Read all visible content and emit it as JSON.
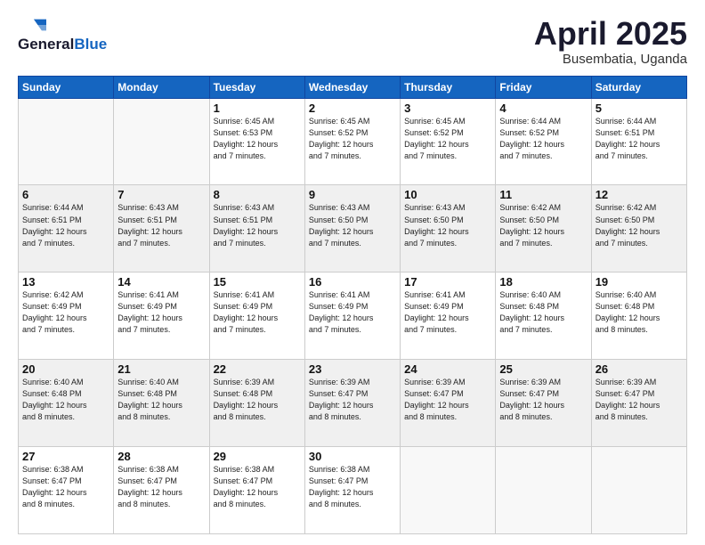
{
  "header": {
    "logo_general": "General",
    "logo_blue": "Blue",
    "month_title": "April 2025",
    "location": "Busembatia, Uganda"
  },
  "days_of_week": [
    "Sunday",
    "Monday",
    "Tuesday",
    "Wednesday",
    "Thursday",
    "Friday",
    "Saturday"
  ],
  "weeks": [
    {
      "shade": "white",
      "days": [
        {
          "num": "",
          "info": ""
        },
        {
          "num": "",
          "info": ""
        },
        {
          "num": "1",
          "info": "Sunrise: 6:45 AM\nSunset: 6:53 PM\nDaylight: 12 hours\nand 7 minutes."
        },
        {
          "num": "2",
          "info": "Sunrise: 6:45 AM\nSunset: 6:52 PM\nDaylight: 12 hours\nand 7 minutes."
        },
        {
          "num": "3",
          "info": "Sunrise: 6:45 AM\nSunset: 6:52 PM\nDaylight: 12 hours\nand 7 minutes."
        },
        {
          "num": "4",
          "info": "Sunrise: 6:44 AM\nSunset: 6:52 PM\nDaylight: 12 hours\nand 7 minutes."
        },
        {
          "num": "5",
          "info": "Sunrise: 6:44 AM\nSunset: 6:51 PM\nDaylight: 12 hours\nand 7 minutes."
        }
      ]
    },
    {
      "shade": "shaded",
      "days": [
        {
          "num": "6",
          "info": "Sunrise: 6:44 AM\nSunset: 6:51 PM\nDaylight: 12 hours\nand 7 minutes."
        },
        {
          "num": "7",
          "info": "Sunrise: 6:43 AM\nSunset: 6:51 PM\nDaylight: 12 hours\nand 7 minutes."
        },
        {
          "num": "8",
          "info": "Sunrise: 6:43 AM\nSunset: 6:51 PM\nDaylight: 12 hours\nand 7 minutes."
        },
        {
          "num": "9",
          "info": "Sunrise: 6:43 AM\nSunset: 6:50 PM\nDaylight: 12 hours\nand 7 minutes."
        },
        {
          "num": "10",
          "info": "Sunrise: 6:43 AM\nSunset: 6:50 PM\nDaylight: 12 hours\nand 7 minutes."
        },
        {
          "num": "11",
          "info": "Sunrise: 6:42 AM\nSunset: 6:50 PM\nDaylight: 12 hours\nand 7 minutes."
        },
        {
          "num": "12",
          "info": "Sunrise: 6:42 AM\nSunset: 6:50 PM\nDaylight: 12 hours\nand 7 minutes."
        }
      ]
    },
    {
      "shade": "white",
      "days": [
        {
          "num": "13",
          "info": "Sunrise: 6:42 AM\nSunset: 6:49 PM\nDaylight: 12 hours\nand 7 minutes."
        },
        {
          "num": "14",
          "info": "Sunrise: 6:41 AM\nSunset: 6:49 PM\nDaylight: 12 hours\nand 7 minutes."
        },
        {
          "num": "15",
          "info": "Sunrise: 6:41 AM\nSunset: 6:49 PM\nDaylight: 12 hours\nand 7 minutes."
        },
        {
          "num": "16",
          "info": "Sunrise: 6:41 AM\nSunset: 6:49 PM\nDaylight: 12 hours\nand 7 minutes."
        },
        {
          "num": "17",
          "info": "Sunrise: 6:41 AM\nSunset: 6:49 PM\nDaylight: 12 hours\nand 7 minutes."
        },
        {
          "num": "18",
          "info": "Sunrise: 6:40 AM\nSunset: 6:48 PM\nDaylight: 12 hours\nand 7 minutes."
        },
        {
          "num": "19",
          "info": "Sunrise: 6:40 AM\nSunset: 6:48 PM\nDaylight: 12 hours\nand 8 minutes."
        }
      ]
    },
    {
      "shade": "shaded",
      "days": [
        {
          "num": "20",
          "info": "Sunrise: 6:40 AM\nSunset: 6:48 PM\nDaylight: 12 hours\nand 8 minutes."
        },
        {
          "num": "21",
          "info": "Sunrise: 6:40 AM\nSunset: 6:48 PM\nDaylight: 12 hours\nand 8 minutes."
        },
        {
          "num": "22",
          "info": "Sunrise: 6:39 AM\nSunset: 6:48 PM\nDaylight: 12 hours\nand 8 minutes."
        },
        {
          "num": "23",
          "info": "Sunrise: 6:39 AM\nSunset: 6:47 PM\nDaylight: 12 hours\nand 8 minutes."
        },
        {
          "num": "24",
          "info": "Sunrise: 6:39 AM\nSunset: 6:47 PM\nDaylight: 12 hours\nand 8 minutes."
        },
        {
          "num": "25",
          "info": "Sunrise: 6:39 AM\nSunset: 6:47 PM\nDaylight: 12 hours\nand 8 minutes."
        },
        {
          "num": "26",
          "info": "Sunrise: 6:39 AM\nSunset: 6:47 PM\nDaylight: 12 hours\nand 8 minutes."
        }
      ]
    },
    {
      "shade": "white",
      "days": [
        {
          "num": "27",
          "info": "Sunrise: 6:38 AM\nSunset: 6:47 PM\nDaylight: 12 hours\nand 8 minutes."
        },
        {
          "num": "28",
          "info": "Sunrise: 6:38 AM\nSunset: 6:47 PM\nDaylight: 12 hours\nand 8 minutes."
        },
        {
          "num": "29",
          "info": "Sunrise: 6:38 AM\nSunset: 6:47 PM\nDaylight: 12 hours\nand 8 minutes."
        },
        {
          "num": "30",
          "info": "Sunrise: 6:38 AM\nSunset: 6:47 PM\nDaylight: 12 hours\nand 8 minutes."
        },
        {
          "num": "",
          "info": ""
        },
        {
          "num": "",
          "info": ""
        },
        {
          "num": "",
          "info": ""
        }
      ]
    }
  ]
}
